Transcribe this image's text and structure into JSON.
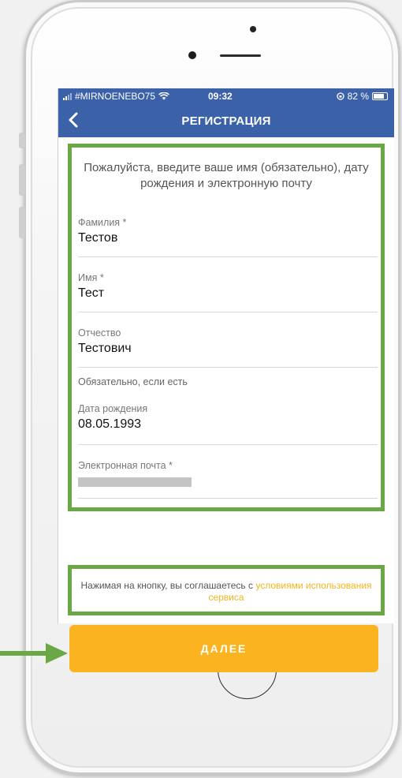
{
  "status_bar": {
    "carrier": "#MIRNOENEBO75",
    "time": "09:32",
    "battery": "82 %"
  },
  "nav": {
    "title": "РЕГИСТРАЦИЯ",
    "back_icon": "chevron-left-icon"
  },
  "form": {
    "intro": "Пожалуйста, введите ваше имя (обязательно), дату рождения и электронную почту",
    "fields": [
      {
        "label": "Фамилия *",
        "value": "Тестов"
      },
      {
        "label": "Имя *",
        "value": "Тест"
      },
      {
        "label": "Отчество",
        "value": "Тестович"
      },
      {
        "label": "Дата рождения",
        "value": "08.05.1993"
      },
      {
        "label": "Электронная почта *",
        "value": ""
      }
    ],
    "patronymic_hint": "Обязательно, если есть"
  },
  "terms": {
    "text": "Нажимая на кнопку, вы соглашаетесь с",
    "link": "условиями использования сервиса"
  },
  "next_button": "ДАЛЕЕ",
  "colors": {
    "header": "#3b61a9",
    "highlight_border": "#6aa846",
    "accent": "#fbb420"
  }
}
